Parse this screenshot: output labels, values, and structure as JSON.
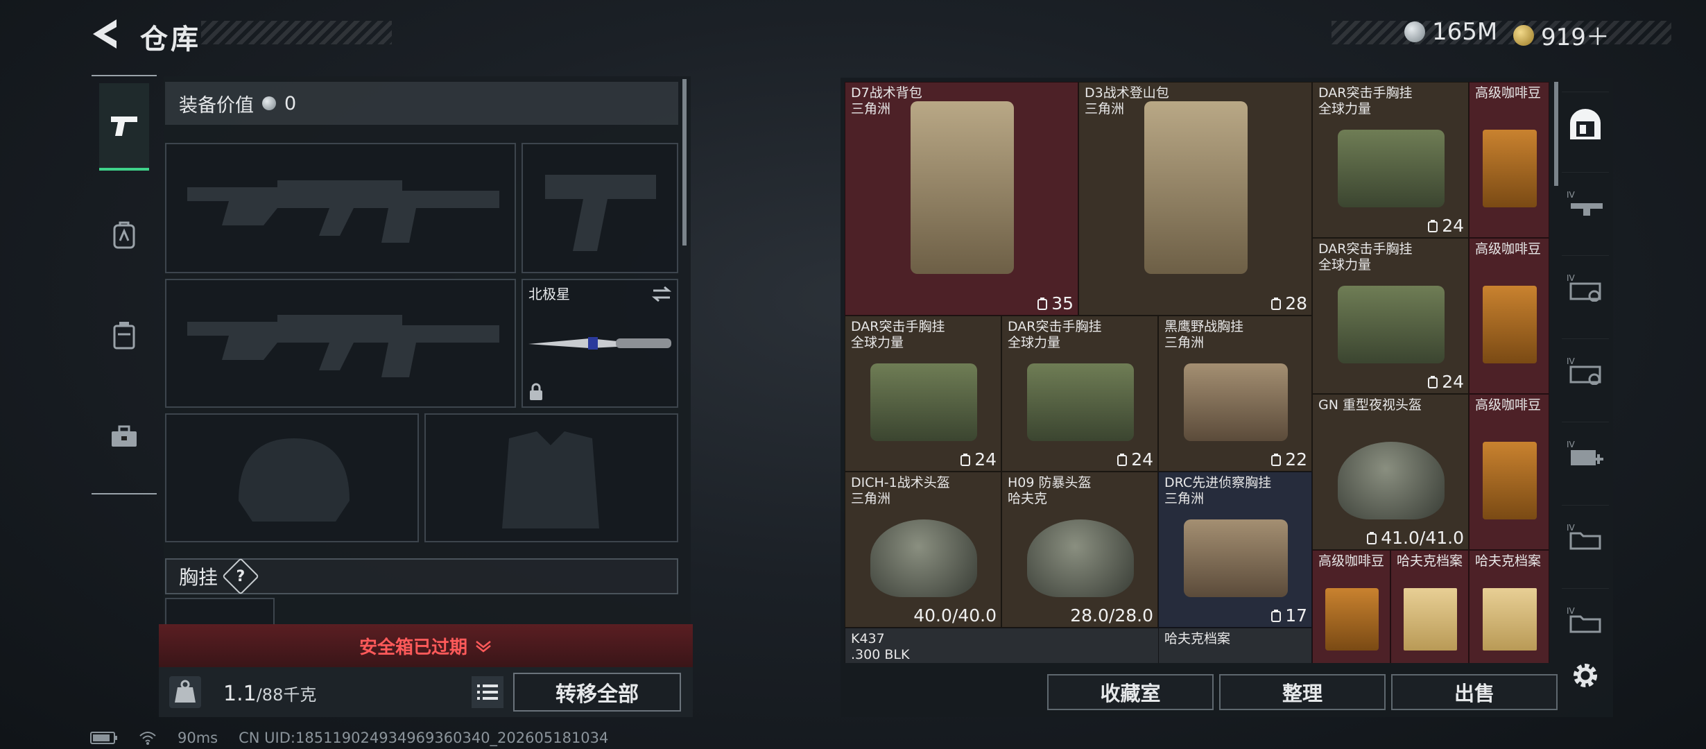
{
  "header": {
    "title": "仓库"
  },
  "currency": [
    {
      "value": "165M",
      "color": "#b9c2c8",
      "icon": "silver-coin-icon"
    },
    {
      "value": "919＋",
      "color": "#d8b04a",
      "icon": "gold-coin-icon"
    }
  ],
  "loadout": {
    "equip_value_label": "装备价值",
    "equip_value": "0",
    "melee_name": "北极星",
    "chest_label": "胸挂",
    "chest_help": "?",
    "safebox_text": "安全箱已过期",
    "weight_current": "1.1",
    "weight_max": "/88千克",
    "transfer_all": "转移全部"
  },
  "stash": {
    "items": [
      {
        "name": "D7战术背包",
        "sub": "三角洲",
        "count": "35",
        "count_icon": "backpack-icon",
        "color": "red"
      },
      {
        "name": "D3战术登山包",
        "sub": "三角洲",
        "count": "28",
        "count_icon": "backpack-icon",
        "color": "brown"
      },
      {
        "name": "DAR突击手胸挂",
        "sub": "全球力量",
        "count": "24",
        "count_icon": "chest-rig-icon",
        "color": "brown"
      },
      {
        "name": "高级咖啡豆",
        "sub": "",
        "count": "",
        "count_icon": "",
        "color": "red"
      },
      {
        "name": "DAR突击手胸挂",
        "sub": "全球力量",
        "count": "24",
        "count_icon": "chest-rig-icon",
        "color": "brown"
      },
      {
        "name": "高级咖啡豆",
        "sub": "",
        "count": "",
        "count_icon": "",
        "color": "red"
      },
      {
        "name": "DAR突击手胸挂",
        "sub": "全球力量",
        "count": "24",
        "count_icon": "chest-rig-icon",
        "color": "brown"
      },
      {
        "name": "DAR突击手胸挂",
        "sub": "全球力量",
        "count": "24",
        "count_icon": "chest-rig-icon",
        "color": "brown"
      },
      {
        "name": "黑鹰野战胸挂",
        "sub": "三角洲",
        "count": "22",
        "count_icon": "chest-rig-icon",
        "color": "brown"
      },
      {
        "name": "GN 重型夜视头盔",
        "sub": "",
        "count": "41.0/41.0",
        "count_icon": "durability-icon",
        "color": "brown"
      },
      {
        "name": "高级咖啡豆",
        "sub": "",
        "count": "",
        "count_icon": "",
        "color": "red"
      },
      {
        "name": "DICH-1战术头盔",
        "sub": "三角洲",
        "count": "40.0/40.0",
        "count_icon": "",
        "color": "brown"
      },
      {
        "name": "H09 防暴头盔",
        "sub": "哈夫克",
        "count": "28.0/28.0",
        "count_icon": "",
        "color": "brown"
      },
      {
        "name": "DRC先进侦察胸挂",
        "sub": "三角洲",
        "count": "17",
        "count_icon": "chest-rig-icon",
        "color": "blue"
      },
      {
        "name": "高级咖啡豆",
        "sub": "",
        "count": "",
        "count_icon": "",
        "color": "red"
      },
      {
        "name": "哈夫克档案",
        "sub": "",
        "count": "",
        "count_icon": "",
        "color": "red"
      },
      {
        "name": "哈夫克档案",
        "sub": "",
        "count": "",
        "count_icon": "",
        "color": "red"
      },
      {
        "name": "K437",
        "sub": ".300 BLK",
        "count": "",
        "count_icon": "",
        "color": "dark"
      },
      {
        "name": "哈夫克档案",
        "sub": "",
        "count": "",
        "count_icon": "",
        "color": "dark"
      }
    ],
    "buttons": {
      "collection": "收藏室",
      "sort": "整理",
      "sell": "出售"
    }
  },
  "status": {
    "ping": "90ms",
    "uid": "CN UID:185119024934969360340_202605181034"
  }
}
